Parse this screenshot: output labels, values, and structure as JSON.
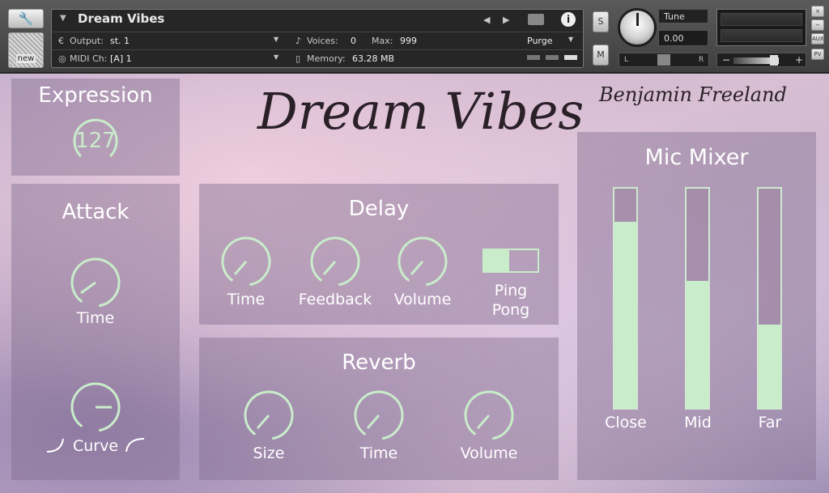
{
  "header": {
    "instrument_name": "Dream Vibes",
    "output_label": "Output:",
    "output_value": "st. 1",
    "voices_label": "Voices:",
    "voices_value": "0",
    "max_label": "Max:",
    "max_value": "999",
    "purge_label": "Purge",
    "midi_label": "MIDI Ch:",
    "midi_value": "[A]  1",
    "memory_label": "Memory:",
    "memory_value": "63.28 MB",
    "new_label": "new",
    "solo_label": "S",
    "mute_label": "M",
    "tune_label": "Tune",
    "tune_value": "0.00",
    "pan_left": "L",
    "pan_right": "R",
    "vol_minus": "−",
    "vol_plus": "+",
    "aux_label": "AUX",
    "pv_label": "PV",
    "close_glyph": "×",
    "minimize_glyph": "−"
  },
  "brand": {
    "title_script": "Dream Vibes",
    "author_script": "Benjamin Freeland"
  },
  "expression": {
    "title": "Expression",
    "value": "127"
  },
  "attack": {
    "title": "Attack",
    "time_label": "Time",
    "curve_label": "Curve"
  },
  "delay": {
    "title": "Delay",
    "time_label": "Time",
    "feedback_label": "Feedback",
    "volume_label": "Volume",
    "ping_label": "Ping",
    "pong_label": "Pong"
  },
  "reverb": {
    "title": "Reverb",
    "size_label": "Size",
    "time_label": "Time",
    "volume_label": "Volume"
  },
  "mic_mixer": {
    "title": "Mic Mixer",
    "channels": [
      {
        "label": "Close",
        "level": 0.85
      },
      {
        "label": "Mid",
        "level": 0.58
      },
      {
        "label": "Far",
        "level": 0.38
      }
    ]
  },
  "colors": {
    "accent": "#c9eccb",
    "panel": "#826e91"
  }
}
